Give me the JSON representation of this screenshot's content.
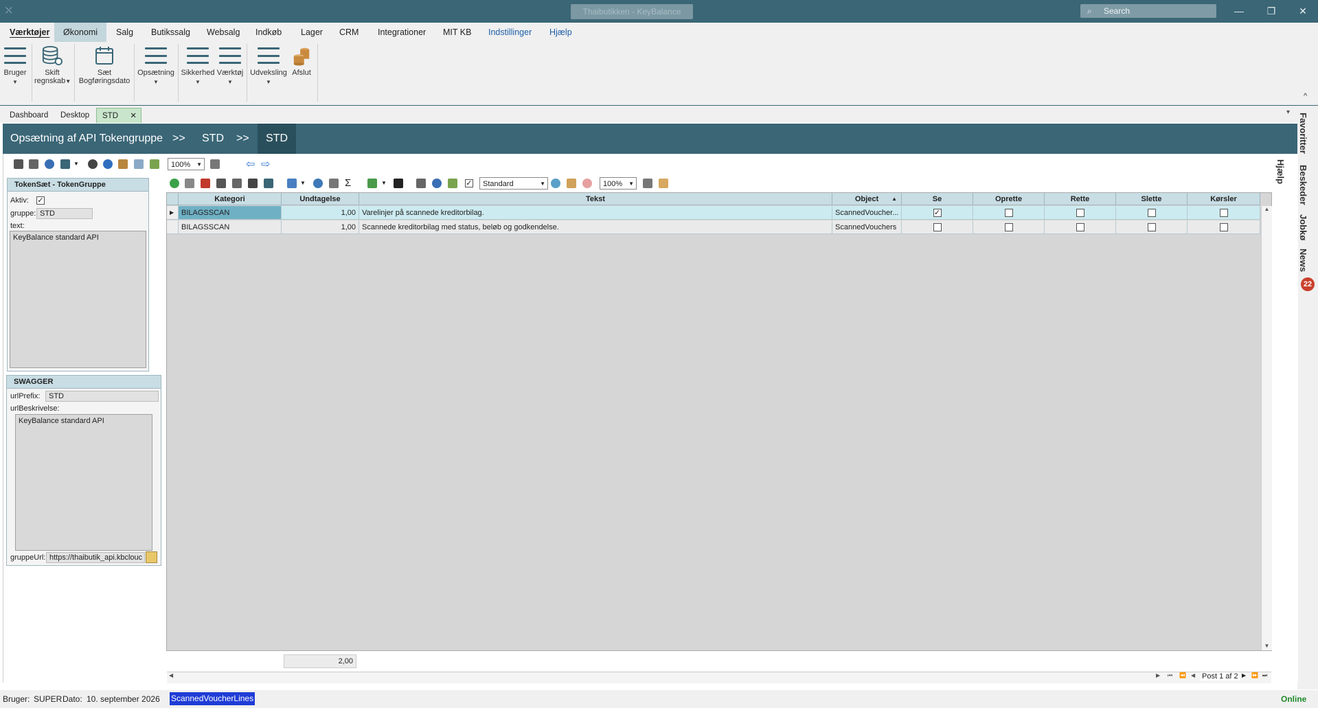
{
  "window": {
    "title": "Thaibutikken - KeyBalance",
    "search_placeholder": "Search",
    "minimize": "—",
    "restore": "❐",
    "close": "✕",
    "back_glyph": "⤬"
  },
  "menu": [
    {
      "label": "Værktøjer"
    },
    {
      "label": "Økonomi"
    },
    {
      "label": "Salg"
    },
    {
      "label": "Butikssalg"
    },
    {
      "label": "Websalg"
    },
    {
      "label": "Indkøb"
    },
    {
      "label": "Lager"
    },
    {
      "label": "CRM"
    },
    {
      "label": "Integrationer"
    },
    {
      "label": "MIT KB"
    },
    {
      "label": "Indstillinger"
    },
    {
      "label": "Hjælp"
    }
  ],
  "ribbon": {
    "bruger": "Bruger",
    "skift_1": "Skift",
    "skift_2": "regnskab",
    "saet_1": "Sæt",
    "saet_2": "Bogføringsdato",
    "opsaetning": "Opsætning",
    "sikkerhed": "Sikkerhed",
    "vaerktoj": "Værktøj",
    "udveksling": "Udveksling",
    "afslut": "Afslut",
    "collapse_glyph": "^"
  },
  "tabs": {
    "dashboard": "Dashboard",
    "desktop": "Desktop",
    "std": "STD",
    "close": "✕",
    "overflow": "▾"
  },
  "sidebar_right": {
    "favoritter": "Favoritter",
    "beskeder": "Beskeder",
    "jobkø": "Jobkø",
    "news": "News",
    "news_count": "22",
    "hjaelp": "Hjælp"
  },
  "breadcrumb": {
    "title": "Opsætning af API Tokengruppe",
    "sep1": ">>",
    "item1": "STD",
    "sep2": ">>",
    "item2": "STD"
  },
  "toolbar": {
    "zoom": "100%",
    "view": "Standard",
    "zoom2": "100%"
  },
  "tokengroup": {
    "header": "TokenSæt - TokenGruppe",
    "aktiv_label": "Aktiv:",
    "aktiv_checked": true,
    "gruppe_label": "gruppe:",
    "gruppe_value": "STD",
    "text_label": "text:",
    "text_value": "KeyBalance standard API"
  },
  "swagger": {
    "header": "SWAGGER",
    "urlprefix_label": "urlPrefix:",
    "urlprefix_value": "STD",
    "urlbeskrivelse_label": "urlBeskrivelse:",
    "urlbeskrivelse_value": "KeyBalance standard API",
    "gruppeurl_label": "gruppeUrl:",
    "gruppeurl_value": "https://thaibutik_api.kbclouc"
  },
  "grid": {
    "columns": [
      "Kategori",
      "Undtagelse",
      "Tekst",
      "Object",
      "Se",
      "Oprette",
      "Rette",
      "Slette",
      "Kørsler"
    ],
    "rows": [
      {
        "kategori": "BILAGSSCAN",
        "undtagelse": "1,00",
        "tekst": "Varelinjer på scannede kreditorbilag.",
        "object": "ScannedVoucher...",
        "se": true,
        "oprette": false,
        "rette": false,
        "slette": false,
        "korsler": false
      },
      {
        "kategori": "BILAGSSCAN",
        "undtagelse": "1,00",
        "tekst": "Scannede kreditorbilag med status, beløb og godkendelse.",
        "object": "ScannedVouchers",
        "se": false,
        "oprette": false,
        "rette": false,
        "slette": false,
        "korsler": false
      }
    ],
    "sum_undtagelse": "2,00",
    "paging": "Post 1 af 2"
  },
  "status": {
    "bruger_label": "Bruger:",
    "bruger": "SUPER",
    "dato_label": "Dato:",
    "dato": "10. september 2026",
    "selection": "ScannedVoucherLines",
    "online": "Online"
  }
}
